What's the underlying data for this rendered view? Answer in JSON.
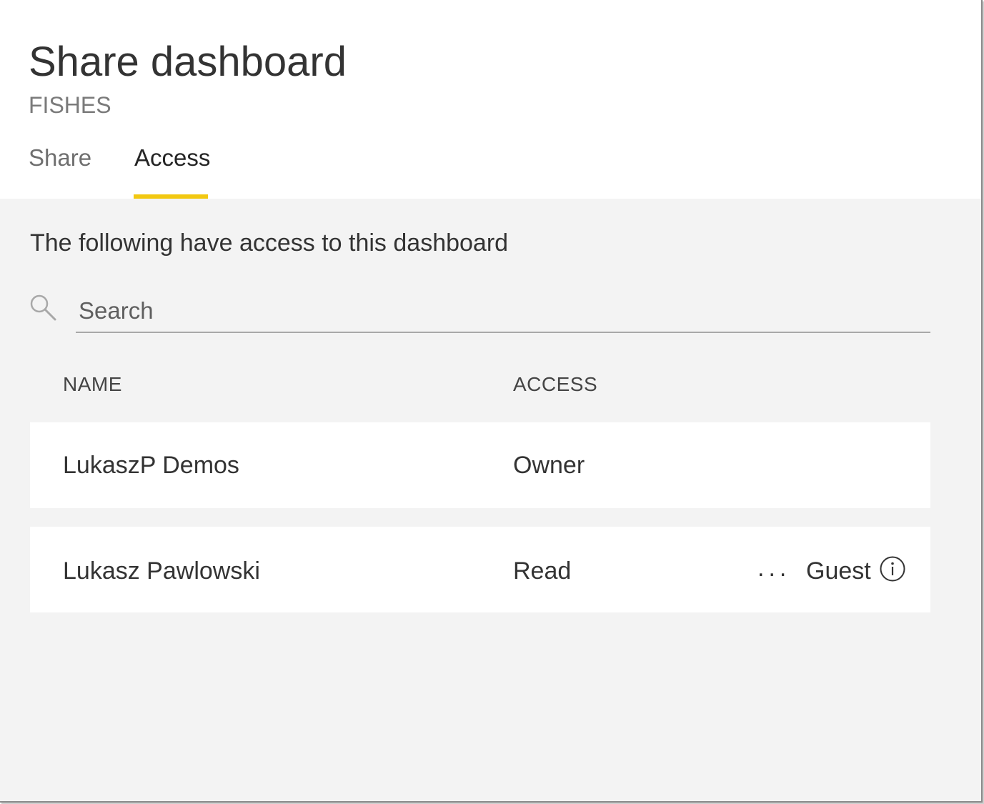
{
  "dialog": {
    "title": "Share dashboard",
    "subtitle": "FISHES"
  },
  "tabs": [
    {
      "label": "Share",
      "selected": false
    },
    {
      "label": "Access",
      "selected": true
    }
  ],
  "access_panel": {
    "description": "The following have access to this dashboard",
    "search": {
      "icon": "search-icon",
      "placeholder": "Search",
      "value": ""
    },
    "columns": {
      "name": "NAME",
      "access": "ACCESS"
    },
    "rows": [
      {
        "name": "LukaszP Demos",
        "access": "Owner"
      },
      {
        "name": "Lukasz Pawlowski",
        "access": "Read",
        "more_label": "...",
        "guest_label": "Guest",
        "info_icon": "info-icon"
      }
    ]
  },
  "colors": {
    "tab_accent": "#f2c811",
    "panel_background": "#f3f3f3",
    "row_background": "#ffffff",
    "text_primary": "#333333",
    "text_secondary": "#7a7a7a"
  }
}
